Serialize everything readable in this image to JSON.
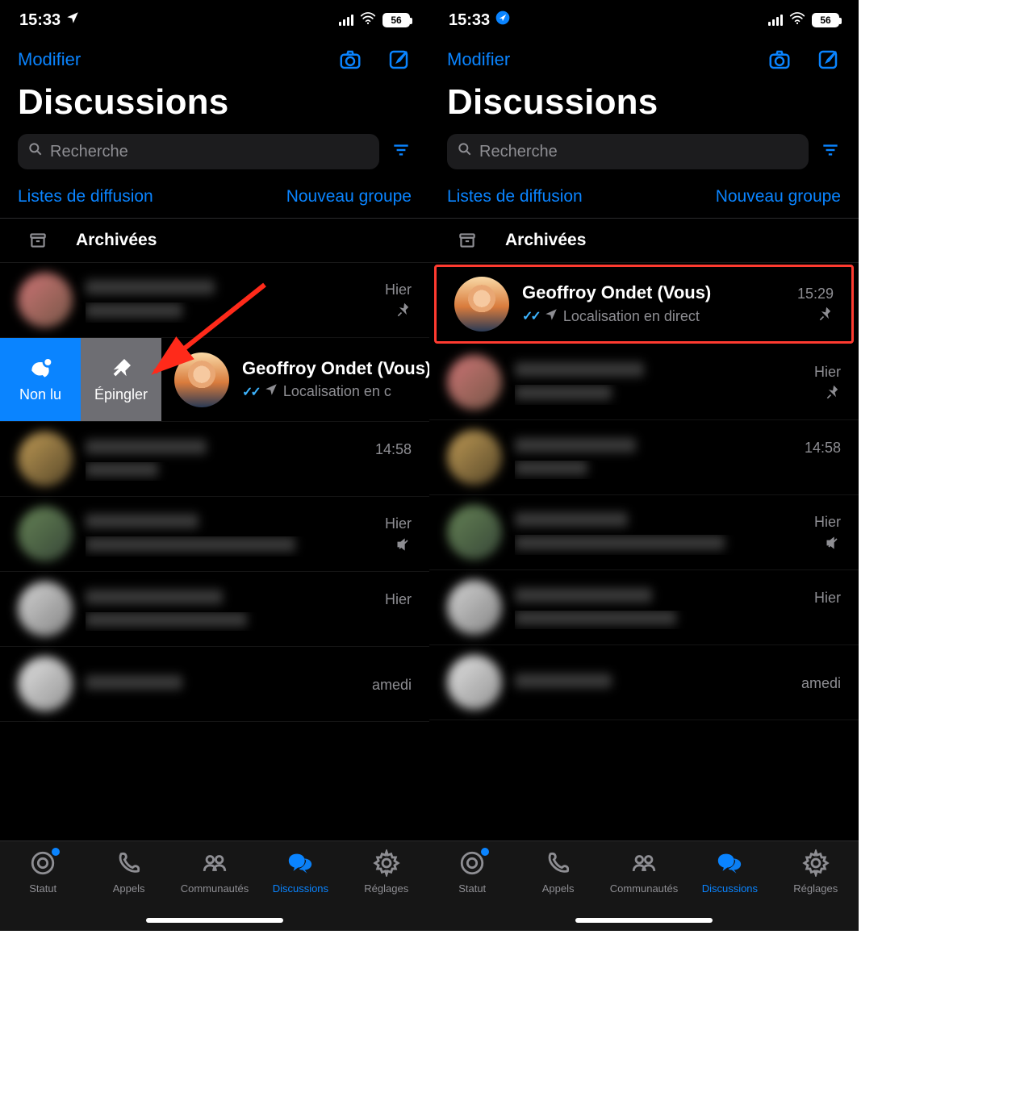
{
  "status": {
    "time": "15:33",
    "battery": "56"
  },
  "nav": {
    "edit": "Modifier"
  },
  "title": "Discussions",
  "search": {
    "placeholder": "Recherche"
  },
  "links": {
    "broadcast": "Listes de diffusion",
    "newgroup": "Nouveau groupe"
  },
  "archived": "Archivées",
  "swipe": {
    "unread": "Non lu",
    "pin": "Épingler"
  },
  "left": {
    "rows": [
      {
        "name_blur": true,
        "time": "Hier",
        "pin": true
      },
      {
        "name": "Geoffroy Ondet (Vous)",
        "sub": "Localisation en c",
        "time": "",
        "ticks": true,
        "loc": true,
        "swipe": true
      },
      {
        "name_blur": true,
        "time": "14:58"
      },
      {
        "name_blur": true,
        "time": "Hier",
        "mute": true
      },
      {
        "name_blur": true,
        "time": "Hier"
      },
      {
        "name_blur": true,
        "time": "amedi"
      }
    ]
  },
  "right": {
    "rows": [
      {
        "name": "Geoffroy Ondet (Vous)",
        "sub": "Localisation en direct",
        "time": "15:29",
        "ticks": true,
        "loc": true,
        "pin": true,
        "highlight": true
      },
      {
        "name_blur": true,
        "time": "Hier",
        "pin": true
      },
      {
        "name_blur": true,
        "time": "14:58"
      },
      {
        "name_blur": true,
        "time": "Hier",
        "mute": true
      },
      {
        "name_blur": true,
        "time": "Hier"
      },
      {
        "name_blur": true,
        "time": "amedi"
      }
    ]
  },
  "tabs": {
    "status": "Statut",
    "calls": "Appels",
    "communities": "Communautés",
    "chats": "Discussions",
    "settings": "Réglages"
  }
}
